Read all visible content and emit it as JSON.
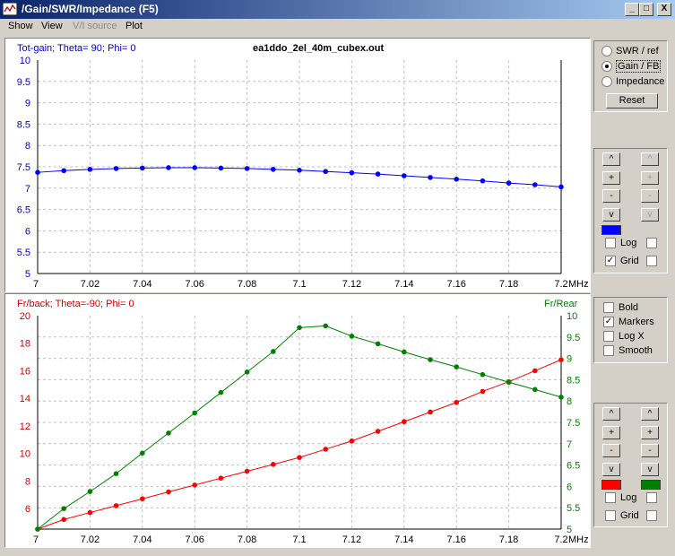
{
  "window": {
    "title": "/Gain/SWR/Impedance (F5)",
    "controls": [
      "_",
      "□",
      "X"
    ]
  },
  "menu": {
    "items": [
      {
        "label": "Show",
        "enabled": true
      },
      {
        "label": "View",
        "enabled": true
      },
      {
        "label": "V/I source",
        "enabled": false
      },
      {
        "label": "Plot",
        "enabled": true
      }
    ]
  },
  "top_plot": {
    "header_left": "Tot-gain; Theta= 90; Phi= 0",
    "header_center": "ea1ddo_2el_40m_cubex.out"
  },
  "bottom_plot": {
    "header_left": "Fr/back; Theta=-90; Phi= 0",
    "header_right": "Fr/Rear"
  },
  "colors": {
    "gain": "#0000ff",
    "frback": "#ff0000",
    "frrear": "#008000",
    "grid": "#c0c0c0"
  },
  "chart_data": [
    {
      "type": "line",
      "title": "Tot-gain; Theta= 90; Phi= 0",
      "xlabel": "MHz",
      "x_ticks": [
        "7",
        "7.02",
        "7.04",
        "7.06",
        "7.08",
        "7.1",
        "7.12",
        "7.14",
        "7.16",
        "7.18",
        "7.2"
      ],
      "y_ticks": [
        "10",
        "9.5",
        "9",
        "8.5",
        "8",
        "7.5",
        "7",
        "6.5",
        "6",
        "5.5",
        "5"
      ],
      "xlim": [
        7.0,
        7.2
      ],
      "ylim": [
        5,
        10
      ],
      "grid": true,
      "series": [
        {
          "color": "#0000ff",
          "x": [
            7.0,
            7.01,
            7.02,
            7.03,
            7.04,
            7.05,
            7.06,
            7.07,
            7.08,
            7.09,
            7.1,
            7.11,
            7.12,
            7.13,
            7.14,
            7.15,
            7.16,
            7.17,
            7.18,
            7.19,
            7.2
          ],
          "y": [
            7.37,
            7.41,
            7.44,
            7.46,
            7.47,
            7.48,
            7.48,
            7.47,
            7.46,
            7.44,
            7.42,
            7.39,
            7.36,
            7.33,
            7.29,
            7.25,
            7.21,
            7.17,
            7.12,
            7.08,
            7.03
          ]
        }
      ]
    },
    {
      "type": "line",
      "title": "Fr/back; Theta=-90; Phi= 0",
      "xlabel": "MHz",
      "x_ticks": [
        "7",
        "7.02",
        "7.04",
        "7.06",
        "7.08",
        "7.1",
        "7.12",
        "7.14",
        "7.16",
        "7.18",
        "7.2"
      ],
      "y_left_ticks": [
        "20",
        "18",
        "16",
        "14",
        "12",
        "10",
        "8",
        "6"
      ],
      "y_right_ticks": [
        "10",
        "9.5",
        "9",
        "8.5",
        "8",
        "7.5",
        "7",
        "6.5",
        "6",
        "5.5",
        "5"
      ],
      "ylim_left": [
        4.5,
        20
      ],
      "ylim_right": [
        5,
        10
      ],
      "ylabel_right": "Fr/Rear",
      "grid": true,
      "series": [
        {
          "color": "#ff0000",
          "axis": "left",
          "x": [
            7.0,
            7.01,
            7.02,
            7.03,
            7.04,
            7.05,
            7.06,
            7.07,
            7.08,
            7.09,
            7.1,
            7.11,
            7.12,
            7.13,
            7.14,
            7.15,
            7.16,
            7.17,
            7.18,
            7.19,
            7.2
          ],
          "y": [
            4.5,
            5.2,
            5.7,
            6.2,
            6.7,
            7.2,
            7.7,
            8.2,
            8.7,
            9.2,
            9.7,
            10.3,
            10.9,
            11.6,
            12.3,
            13.0,
            13.7,
            14.5,
            15.2,
            16.0,
            16.8
          ]
        },
        {
          "color": "#008000",
          "axis": "right",
          "x": [
            7.0,
            7.01,
            7.02,
            7.03,
            7.04,
            7.05,
            7.06,
            7.07,
            7.08,
            7.09,
            7.1,
            7.11,
            7.12,
            7.13,
            7.14,
            7.15,
            7.16,
            7.17,
            7.18,
            7.19,
            7.2
          ],
          "y": [
            5.0,
            5.48,
            5.88,
            6.3,
            6.78,
            7.25,
            7.72,
            8.2,
            8.68,
            9.16,
            9.72,
            9.76,
            9.52,
            9.34,
            9.15,
            8.97,
            8.8,
            8.62,
            8.44,
            8.27,
            8.09
          ]
        }
      ]
    }
  ],
  "right_panel": {
    "radios": [
      {
        "label": "SWR / ref",
        "checked": false
      },
      {
        "label": "Gain / FB",
        "checked": true
      },
      {
        "label": "Impedance",
        "checked": false
      }
    ],
    "reset_label": "Reset",
    "top_scale": {
      "left_buttons": [
        "^",
        "+",
        "-",
        "v"
      ],
      "right_buttons": [
        "^",
        "+",
        "-",
        "v"
      ],
      "swatch": "#0000ff",
      "log_label": "Log",
      "grid_label": "Grid",
      "log_checked": false,
      "grid_checked": true
    },
    "options": [
      {
        "label": "Bold",
        "checked": false
      },
      {
        "label": "Markers",
        "checked": true
      },
      {
        "label": "Log X",
        "checked": false
      },
      {
        "label": "Smooth",
        "checked": false
      }
    ],
    "bottom_scale": {
      "left_buttons": [
        "^",
        "+",
        "-",
        "v"
      ],
      "right_buttons": [
        "^",
        "+",
        "-",
        "v"
      ],
      "left_swatch": "#ff0000",
      "right_swatch": "#008000",
      "log_label": "Log",
      "grid_label": "Grid",
      "log_checked": false,
      "grid_checked": false
    }
  }
}
